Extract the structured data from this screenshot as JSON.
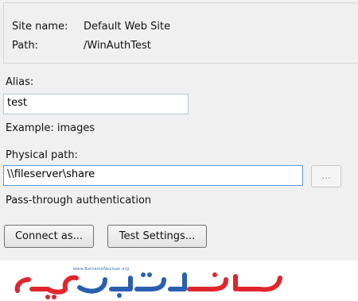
{
  "site_info": {
    "site_name_label": "Site name:",
    "site_name_value": "Default Web Site",
    "path_label": "Path:",
    "path_value": "/WinAuthTest"
  },
  "alias": {
    "label": "Alias:",
    "value": "test",
    "example": "Example: images"
  },
  "physical_path": {
    "label": "Physical path:",
    "value": "\\\\fileserver\\share",
    "browse_label": "..."
  },
  "auth_text": "Pass-through authentication",
  "buttons": {
    "connect_as": "Connect as...",
    "test_settings": "Test Settings..."
  },
  "watermark": {
    "url": "www.BarnameNevisan.org",
    "colors": {
      "red": "#e0262d",
      "blue": "#2a5fb0"
    }
  }
}
